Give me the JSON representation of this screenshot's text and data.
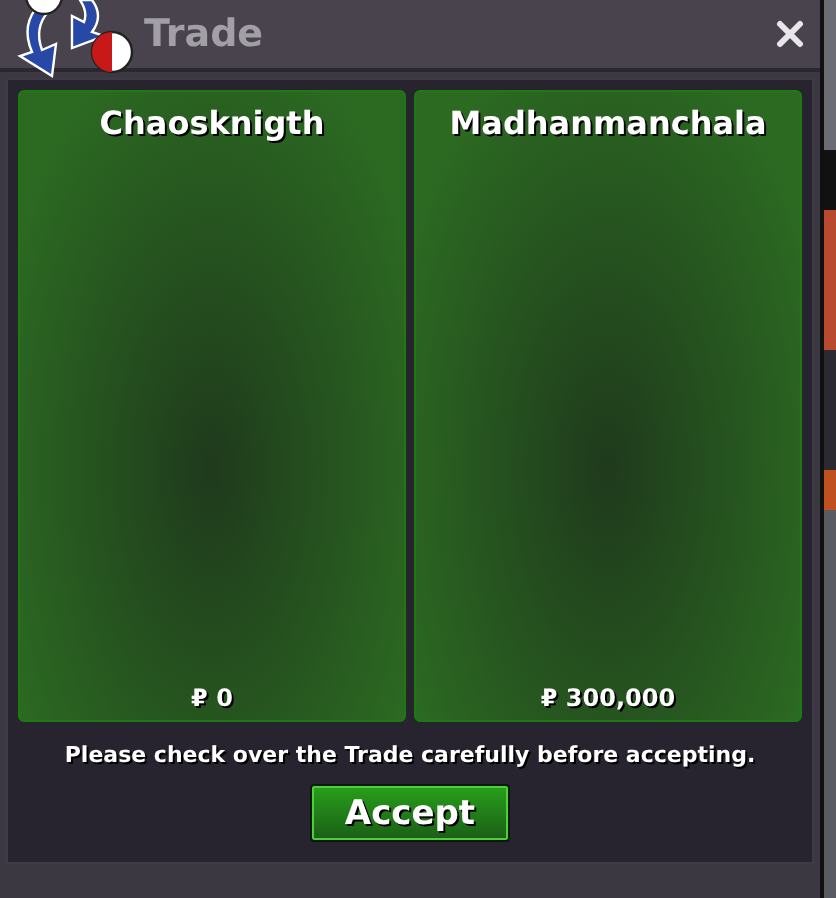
{
  "window": {
    "title": "Trade"
  },
  "offers": [
    {
      "player": "Chaosknigth",
      "money": "₽ 0"
    },
    {
      "player": "Madhanmanchala",
      "money": "₽ 300,000"
    }
  ],
  "notice": "Please check over the Trade carefully before accepting.",
  "accept_button": "Accept"
}
